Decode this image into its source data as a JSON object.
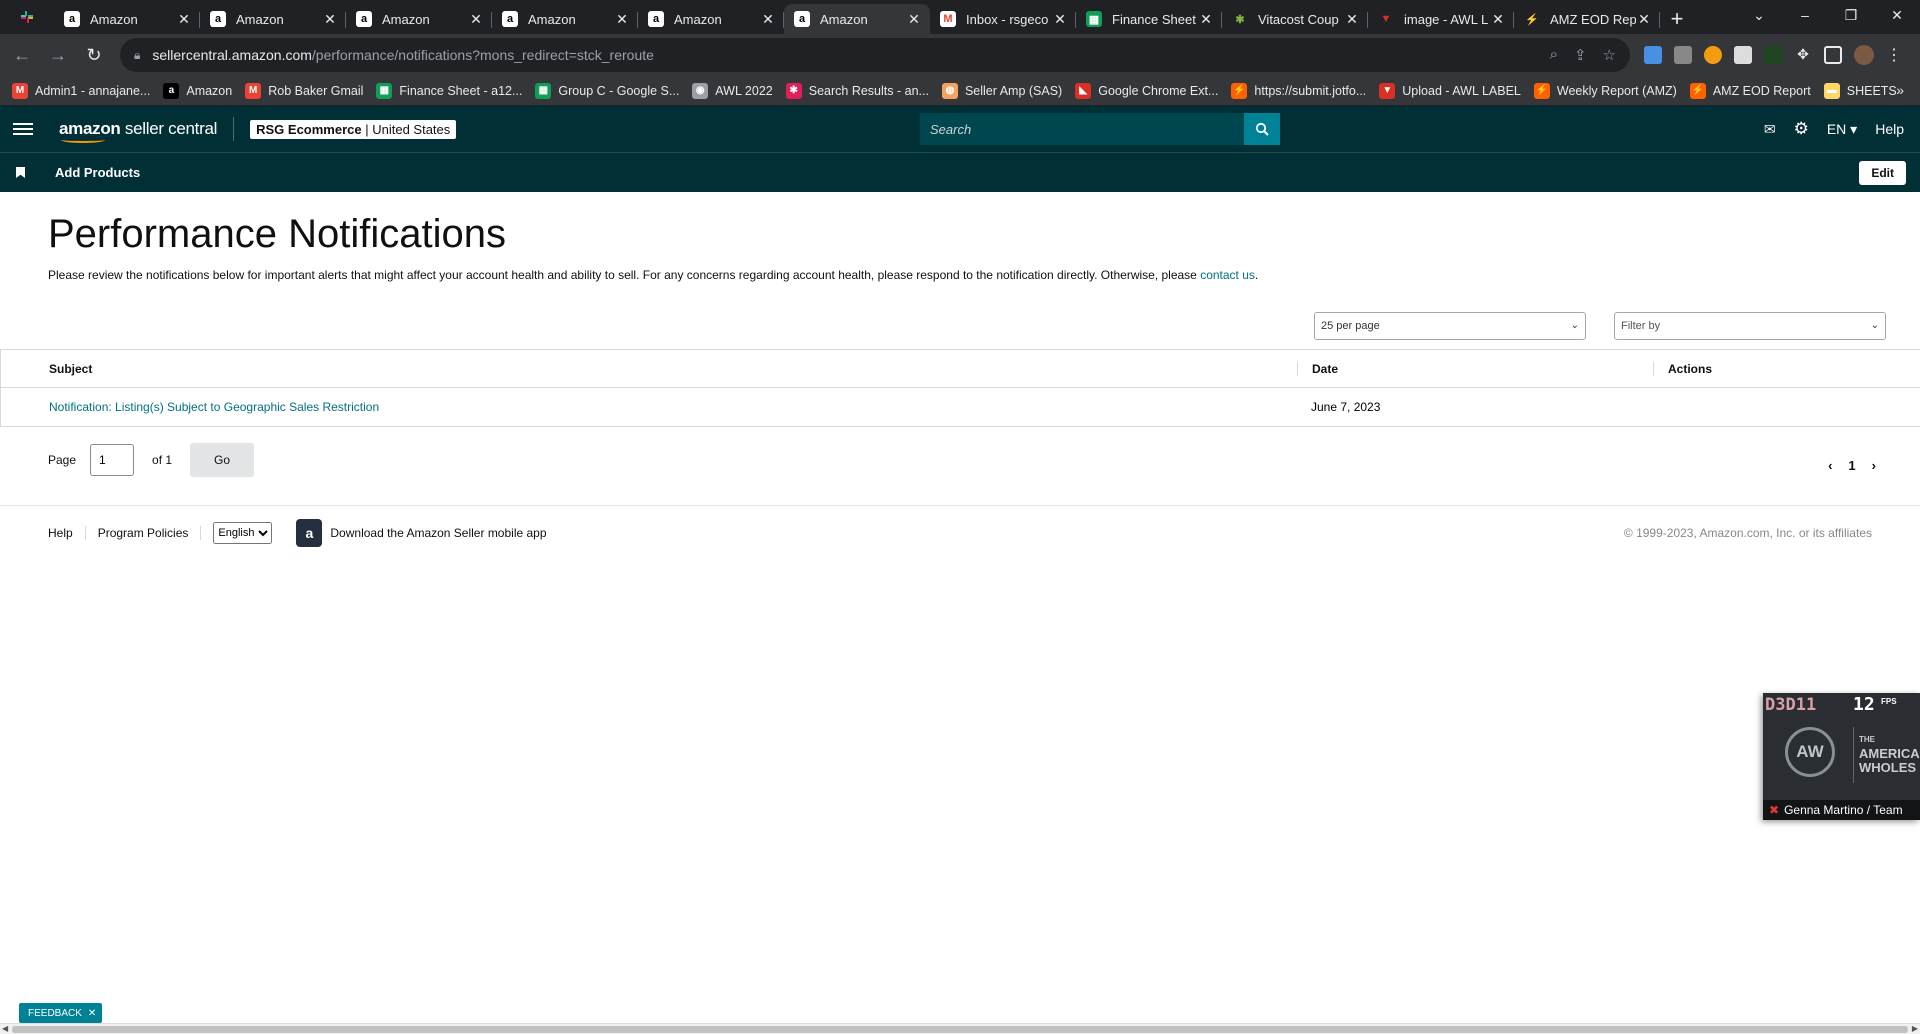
{
  "browser": {
    "tabs": [
      {
        "title": "Amazon",
        "icon": "amazon-a",
        "active": false
      },
      {
        "title": "Amazon",
        "icon": "amazon-a",
        "active": false
      },
      {
        "title": "Amazon",
        "icon": "amazon-a",
        "active": false
      },
      {
        "title": "Amazon",
        "icon": "amazon-a",
        "active": false
      },
      {
        "title": "Amazon",
        "icon": "amazon-a",
        "active": false
      },
      {
        "title": "Amazon",
        "icon": "amazon-a",
        "active": true
      },
      {
        "title": "Inbox - rsgeco",
        "icon": "gmail",
        "active": false
      },
      {
        "title": "Finance Sheet",
        "icon": "sheets",
        "active": false
      },
      {
        "title": "Vitacost Coup",
        "icon": "vitacost",
        "active": false
      },
      {
        "title": "image - AWL L",
        "icon": "awl",
        "active": false
      },
      {
        "title": "AMZ EOD Rep",
        "icon": "jotform",
        "active": false
      }
    ],
    "url_host": "sellercentral.amazon.com",
    "url_path": "/performance/notifications?mons_redirect=stck_reroute",
    "bookmarks": [
      {
        "label": "Admin1 - annajane...",
        "icon": "gmail",
        "color": "#ea4335"
      },
      {
        "label": "Amazon",
        "icon": "amazon-a",
        "color": "#000000"
      },
      {
        "label": "Rob Baker Gmail",
        "icon": "gmail",
        "color": "#ea4335"
      },
      {
        "label": "Finance Sheet - a12...",
        "icon": "sheets",
        "color": "#0f9d58"
      },
      {
        "label": "Group C - Google S...",
        "icon": "sheets",
        "color": "#0f9d58"
      },
      {
        "label": "AWL 2022",
        "icon": "globe",
        "color": "#9aa0a6"
      },
      {
        "label": "Search Results - an...",
        "icon": "slack",
        "color": "#e01e5a"
      },
      {
        "label": "Seller Amp (SAS)",
        "icon": "selleramp",
        "color": "#f4a261"
      },
      {
        "label": "Google Chrome Ext...",
        "icon": "chrome-ext",
        "color": "#d93025"
      },
      {
        "label": "https://submit.jotfo...",
        "icon": "jotform",
        "color": "#ff6100"
      },
      {
        "label": "Upload - AWL LABEL",
        "icon": "awl",
        "color": "#d93025"
      },
      {
        "label": "Weekly Report (AMZ)",
        "icon": "jotform",
        "color": "#ff6100"
      },
      {
        "label": "AMZ EOD Report",
        "icon": "jotform",
        "color": "#ff6100"
      },
      {
        "label": "SHEETS",
        "icon": "folder",
        "color": "#fdd663"
      }
    ]
  },
  "header": {
    "logo_text_bold": "amazon",
    "logo_text": " seller central",
    "account_name": "RSG Ecommerce",
    "account_region": "United States",
    "search_placeholder": "Search",
    "language": "EN",
    "help": "Help",
    "accent": "#002f36",
    "search_btn_color": "#008296"
  },
  "subnav": {
    "link": "Add Products",
    "edit": "Edit"
  },
  "main": {
    "title": "Performance Notifications",
    "description": "Please review the notifications below for important alerts that might affect your account health and ability to sell. For any concerns regarding account health, please respond to the notification directly. Otherwise, please ",
    "contact_link": "contact us",
    "description_end": ".",
    "per_page": "25 per page",
    "filter": "Filter by",
    "columns": [
      "Subject",
      "Date",
      "Actions"
    ],
    "rows": [
      {
        "subject": "Notification: Listing(s) Subject to Geographic Sales Restriction",
        "date": "June 7, 2023",
        "actions": ""
      }
    ],
    "pager": {
      "page_label": "Page",
      "page_value": "1",
      "of_label": "of 1",
      "go": "Go",
      "current": "1"
    }
  },
  "footer": {
    "help": "Help",
    "policies": "Program Policies",
    "language": "English",
    "app_text": "Download the Amazon Seller mobile app",
    "copyright": "© 1999-2023, Amazon.com, Inc. or its affiliates"
  },
  "overlay": {
    "d3d": "D3D11",
    "fps": "12",
    "fps_label": "FPS",
    "logo": "AW",
    "brand_line1": "THE",
    "brand_line2": "AMERICA",
    "brand_line3": "WHOLES",
    "participant": "Genna Martino / Team"
  },
  "feedback": "FEEDBACK"
}
